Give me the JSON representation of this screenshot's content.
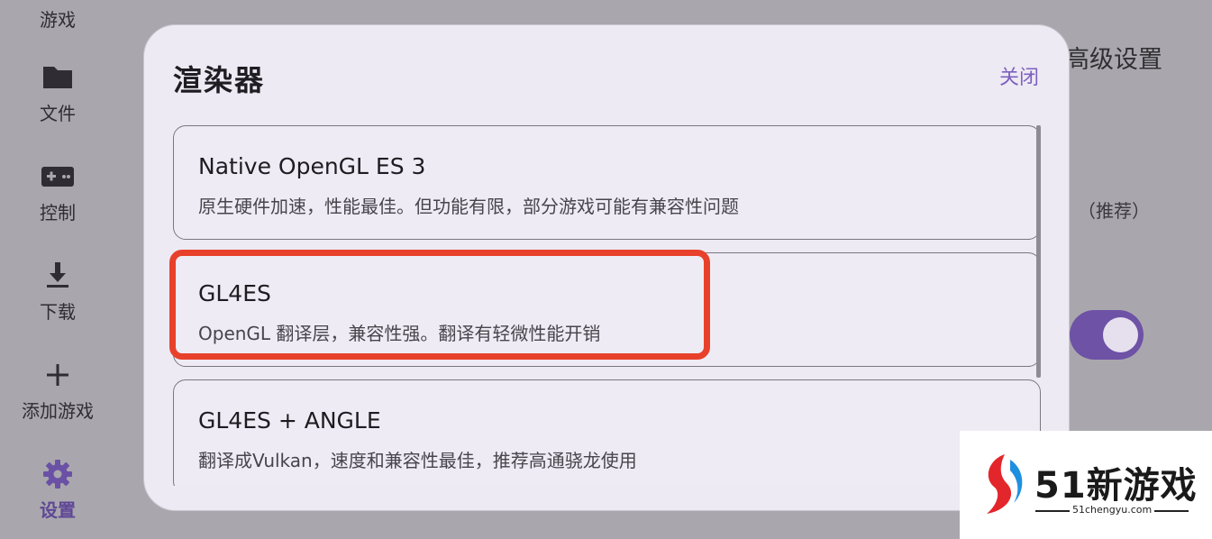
{
  "sidebar": {
    "items": [
      {
        "label": "游戏",
        "icon": "gamepad-icon"
      },
      {
        "label": "文件",
        "icon": "folder-icon"
      },
      {
        "label": "控制",
        "icon": "controller-icon"
      },
      {
        "label": "下载",
        "icon": "download-icon"
      },
      {
        "label": "添加游戏",
        "icon": "plus-icon"
      },
      {
        "label": "设置",
        "icon": "gear-icon",
        "active": true
      }
    ]
  },
  "background": {
    "title_fragment": "高级设置",
    "recommend_text": "（推荐）",
    "toggle_on": true
  },
  "dialog": {
    "title": "渲染器",
    "close_label": "关闭",
    "options": [
      {
        "name": "Native OpenGL ES 3",
        "description": "原生硬件加速，性能最佳。但功能有限，部分游戏可能有兼容性问题"
      },
      {
        "name": "GL4ES",
        "description": "OpenGL 翻译层，兼容性强。翻译有轻微性能开销",
        "highlighted": true
      },
      {
        "name": "GL4ES + ANGLE",
        "description": "翻译成Vulkan，速度和兼容性最佳，推荐高通骁龙使用"
      }
    ]
  },
  "watermark": {
    "brand": "51新游戏",
    "url": "51chengyu.com"
  },
  "colors": {
    "accent": "#7d61bf",
    "highlight_border": "#e8412b",
    "scrim": "#a9a7ad"
  }
}
